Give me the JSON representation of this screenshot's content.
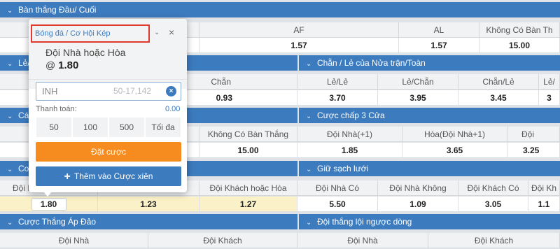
{
  "sections": {
    "s1": {
      "title": "Bàn thắng Đầu/ Cuối",
      "headers": [
        "AF",
        "AL",
        "Không Có Bàn Th"
      ],
      "values": [
        "1.57",
        "1.57",
        "15.00"
      ]
    },
    "s2_left": {
      "title": "Lẻ/"
    },
    "s2_right": {
      "title": "Chẵn / Lẻ của Nửa trận/Toàn"
    },
    "s2": {
      "headers": [
        "Chẵn",
        "Lẻ/Lẻ",
        "Lẻ/Chẵn",
        "Chẵn/Lẻ",
        "Lẻ/"
      ],
      "values": [
        "0.93",
        "3.70",
        "3.95",
        "3.45",
        "3"
      ]
    },
    "s3_left": {
      "title": "Cá"
    },
    "s3_right": {
      "title": "Cược chấp 3 Cửa"
    },
    "s3": {
      "headers": [
        "Không Có Bàn Thắng",
        "Đội Nhà(+1)",
        "Hòa(Đội Nhà+1)",
        "Đội Khách"
      ],
      "values": [
        "15.00",
        "1.85",
        "3.65",
        "3.25"
      ]
    },
    "s4_left": {
      "title": "Cơ"
    },
    "s4_right": {
      "title": "Giữ sạch lưới"
    },
    "s4": {
      "headers": [
        "Đội N",
        "Đội Khách hoặc Hòa",
        "Đội Nhà Có",
        "Đội Nhà Không",
        "Đội Khách Có",
        "Đội Kh"
      ],
      "values": [
        "1.80",
        "1.23",
        "1.27",
        "5.50",
        "1.09",
        "3.05",
        "1.1"
      ]
    },
    "s5_left": {
      "title": "Cược Thắng Áp Đảo"
    },
    "s5_right": {
      "title": "Đội thắng lội ngược dòng"
    },
    "s5": {
      "headers": [
        "Đội Nhà",
        "Đội Khách",
        "Đội Nhà",
        "Đội Khách"
      ]
    }
  },
  "slip": {
    "market": "Bóng đá / Cơ Hội Kép",
    "selection": "Đội Nhà hoặc Hòa",
    "odds_prefix": "@",
    "odds": "1.80",
    "stake_value": "INH",
    "stake_range": "50-17,142",
    "payout_label": "Thanh toán:",
    "payout_value": "0.00",
    "amounts": [
      "50",
      "100",
      "500",
      "Tối đa"
    ],
    "place_label": "Đặt cược",
    "parlay_label": "Thêm vào Cược xiên"
  },
  "colors": {
    "accent": "#3d7bbf",
    "place": "#f68b1f",
    "highlight": "#e03a2e",
    "selected": "#fbf1c9"
  }
}
